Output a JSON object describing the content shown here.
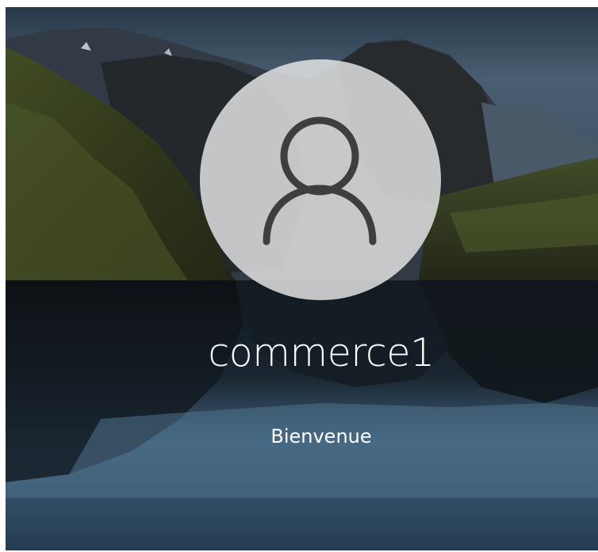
{
  "login": {
    "username": "commerce1",
    "status_message": "Bienvenue",
    "avatar_icon": "user-icon"
  },
  "theme": {
    "sky": "#3f5a73",
    "water": "#4f7799",
    "text": "#ffffff",
    "avatar_bg": "#e5e5e5",
    "avatar_icon_color": "#3e3e3e"
  }
}
